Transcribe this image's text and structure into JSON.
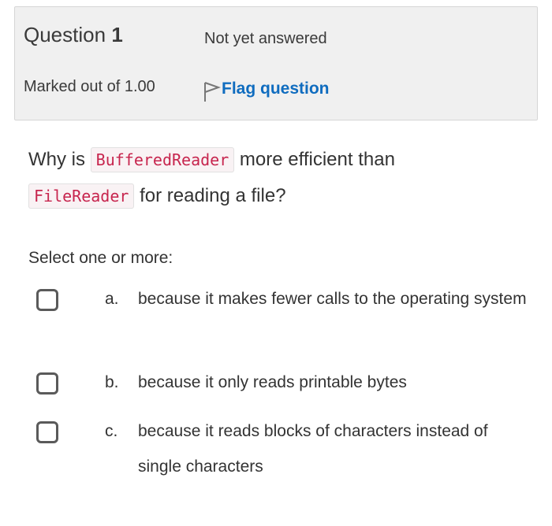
{
  "info": {
    "question_label": "Question",
    "question_number": "1",
    "state": "Not yet answered",
    "grade": "Marked out of 1.00",
    "flag_label": "Flag question"
  },
  "question": {
    "part1": "Why is",
    "code1": "BufferedReader",
    "part2": "more efficient than",
    "code2": "FileReader",
    "part3": "for reading a file?"
  },
  "prompt": "Select one or more:",
  "options": [
    {
      "letter": "a.",
      "text": "because it makes fewer calls to the operating system",
      "checked": false
    },
    {
      "letter": "b.",
      "text": "because it only reads printable bytes",
      "checked": false
    },
    {
      "letter": "c.",
      "text": "because it reads blocks of characters instead of single characters",
      "checked": false
    }
  ],
  "colors": {
    "link": "#0f6cbf",
    "code_text": "#c7254e",
    "code_bg": "#f9f2f4",
    "info_bg": "#f0f0f0"
  },
  "icons": {
    "flag": "flag-outline-icon"
  }
}
